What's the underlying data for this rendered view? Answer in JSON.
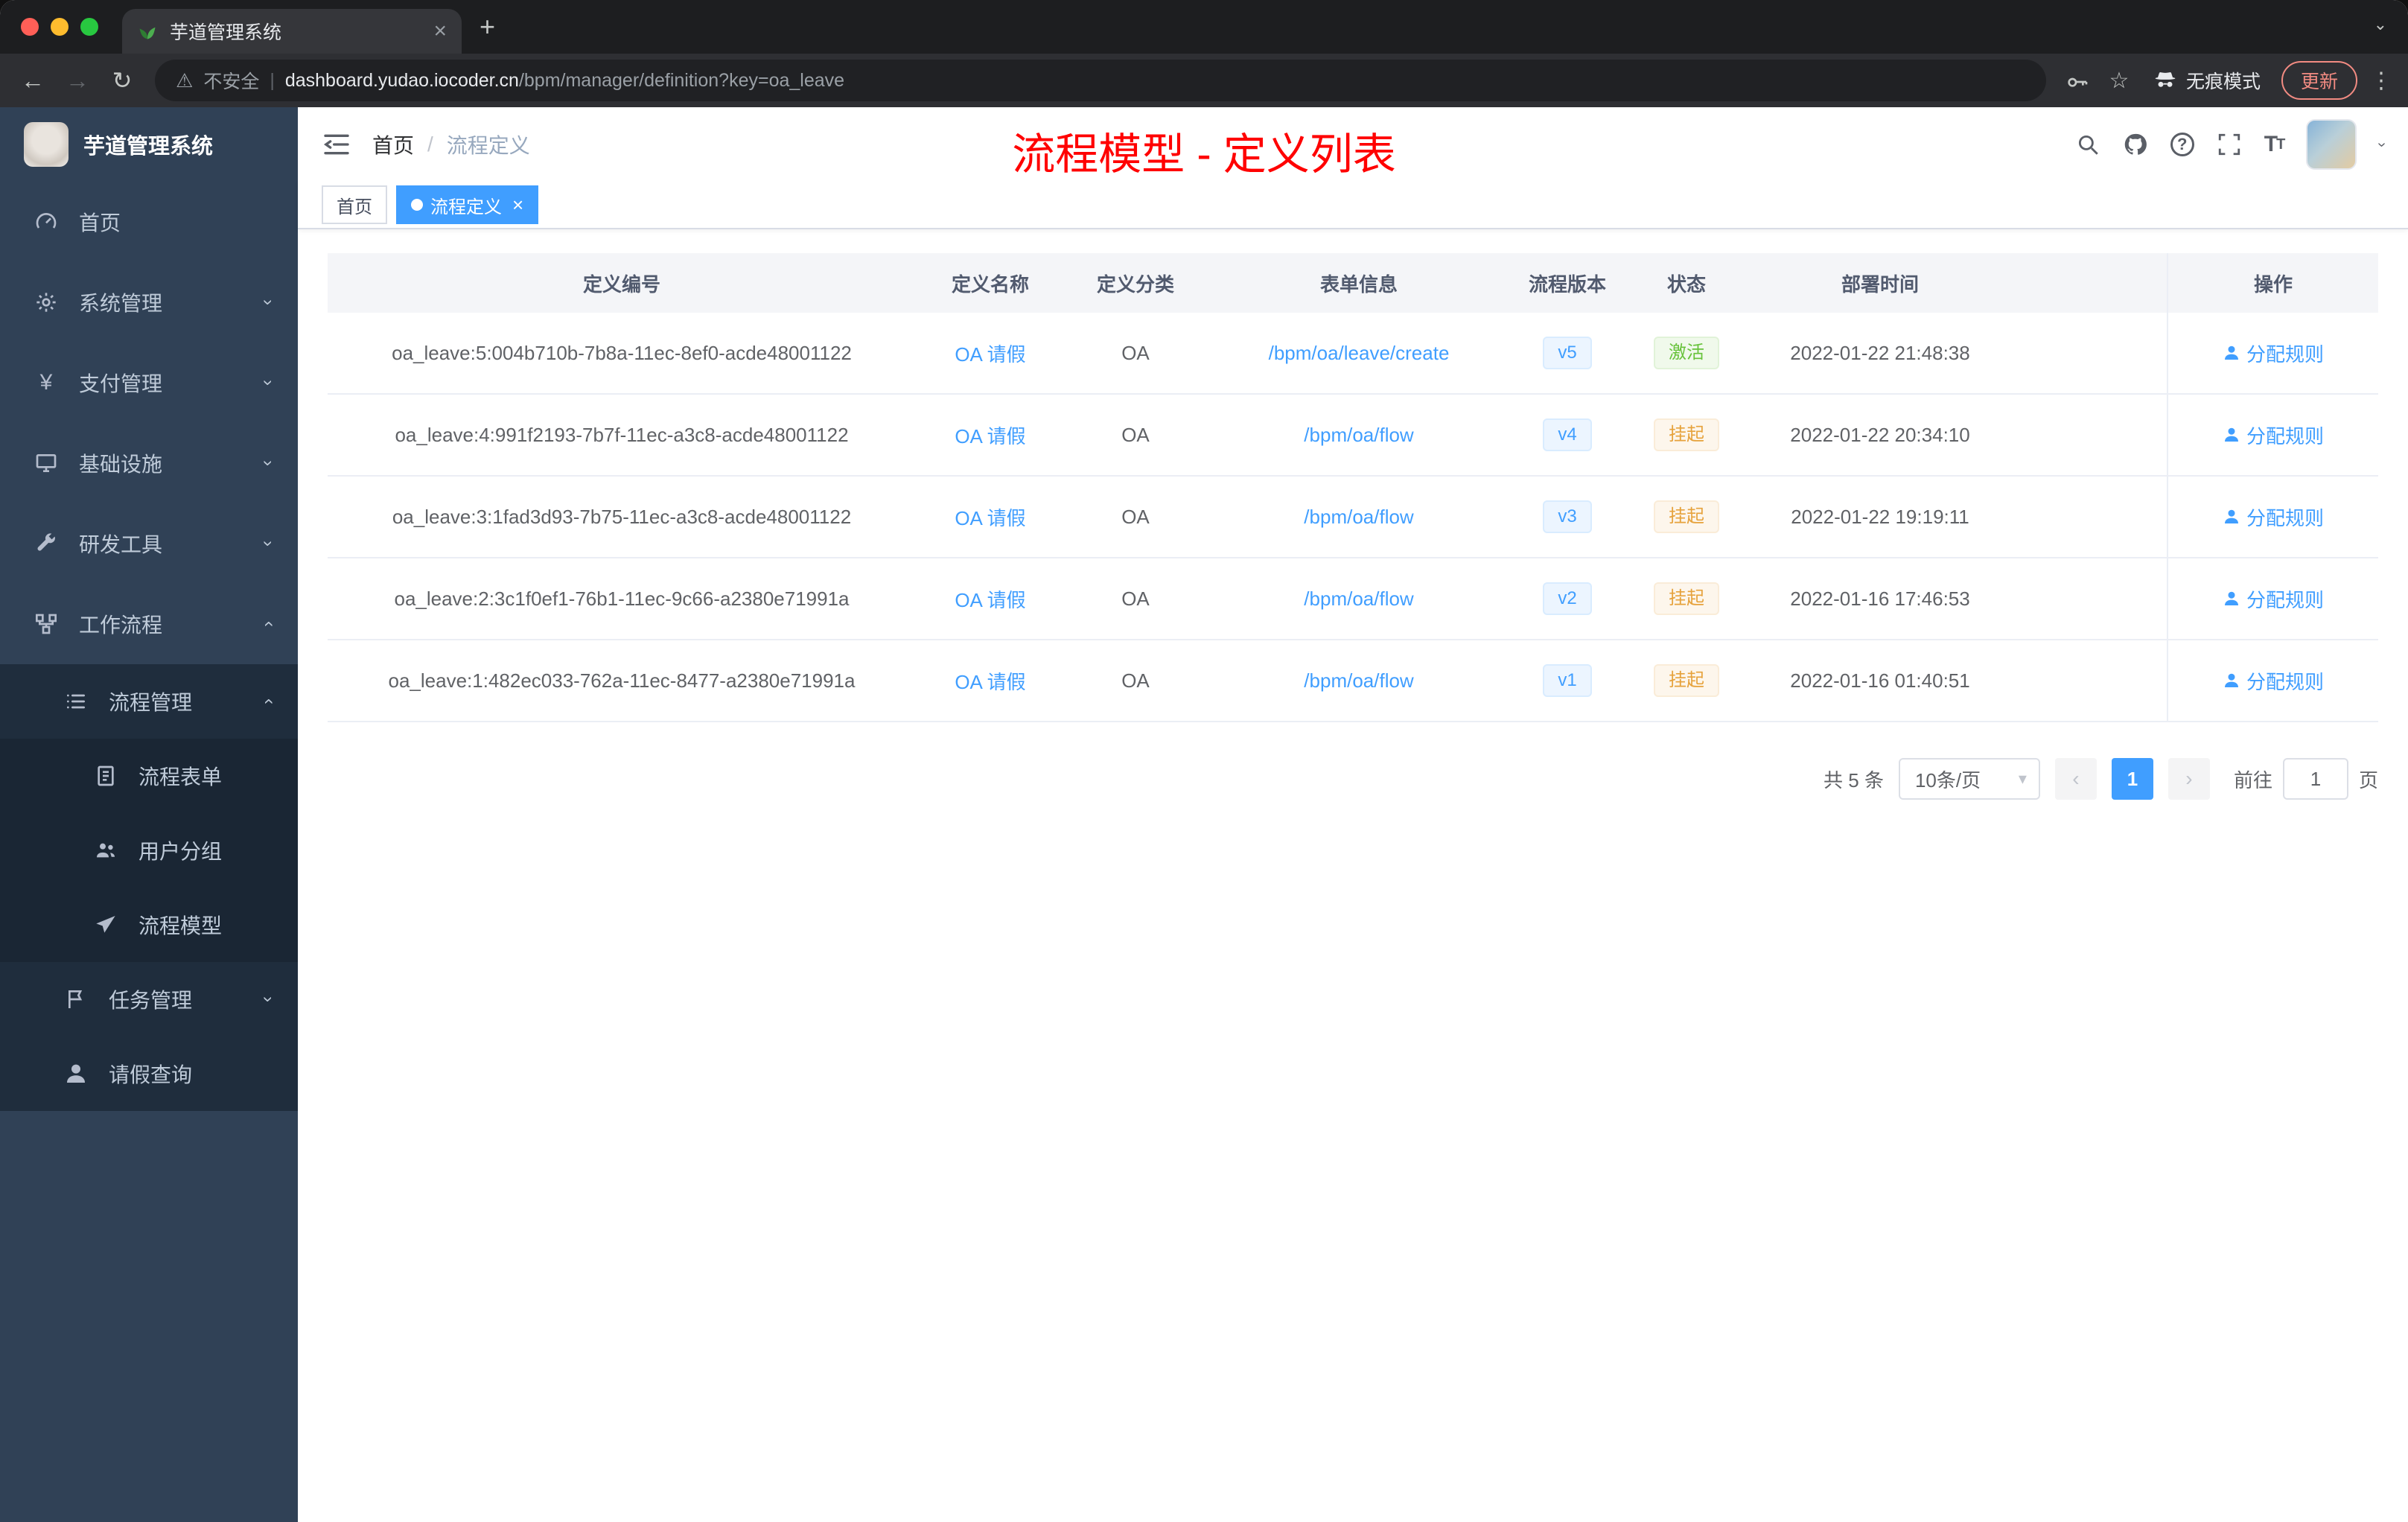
{
  "browser": {
    "tab_title": "芋道管理系统",
    "security_label": "不安全",
    "url_host": "dashboard.yudao.iocoder.cn",
    "url_path": "/bpm/manager/definition?key=oa_leave",
    "incognito_label": "无痕模式",
    "update_label": "更新"
  },
  "sidebar": {
    "logo_title": "芋道管理系统",
    "items": [
      {
        "label": "首页"
      },
      {
        "label": "系统管理"
      },
      {
        "label": "支付管理"
      },
      {
        "label": "基础设施"
      },
      {
        "label": "研发工具"
      },
      {
        "label": "工作流程"
      },
      {
        "label": "流程管理"
      },
      {
        "label": "流程表单"
      },
      {
        "label": "用户分组"
      },
      {
        "label": "流程模型"
      },
      {
        "label": "任务管理"
      },
      {
        "label": "请假查询"
      }
    ]
  },
  "header": {
    "breadcrumb_home": "首页",
    "breadcrumb_sep": "/",
    "breadcrumb_current": "流程定义",
    "overlay_title": "流程模型 - 定义列表"
  },
  "tags": {
    "home": "首页",
    "active": "流程定义"
  },
  "table": {
    "columns": {
      "id": "定义编号",
      "name": "定义名称",
      "category": "定义分类",
      "form": "表单信息",
      "version": "流程版本",
      "status": "状态",
      "time": "部署时间",
      "action": "操作"
    },
    "action_label": "分配规则",
    "rows": [
      {
        "id": "oa_leave:5:004b710b-7b8a-11ec-8ef0-acde48001122",
        "name": "OA 请假",
        "category": "OA",
        "form": "/bpm/oa/leave/create",
        "version": "v5",
        "status": "激活",
        "time": "2022-01-22 21:48:38"
      },
      {
        "id": "oa_leave:4:991f2193-7b7f-11ec-a3c8-acde48001122",
        "name": "OA 请假",
        "category": "OA",
        "form": "/bpm/oa/flow",
        "version": "v4",
        "status": "挂起",
        "time": "2022-01-22 20:34:10"
      },
      {
        "id": "oa_leave:3:1fad3d93-7b75-11ec-a3c8-acde48001122",
        "name": "OA 请假",
        "category": "OA",
        "form": "/bpm/oa/flow",
        "version": "v3",
        "status": "挂起",
        "time": "2022-01-22 19:19:11"
      },
      {
        "id": "oa_leave:2:3c1f0ef1-76b1-11ec-9c66-a2380e71991a",
        "name": "OA 请假",
        "category": "OA",
        "form": "/bpm/oa/flow",
        "version": "v2",
        "status": "挂起",
        "time": "2022-01-16 17:46:53"
      },
      {
        "id": "oa_leave:1:482ec033-762a-11ec-8477-a2380e71991a",
        "name": "OA 请假",
        "category": "OA",
        "form": "/bpm/oa/flow",
        "version": "v1",
        "status": "挂起",
        "time": "2022-01-16 01:40:51"
      }
    ]
  },
  "pagination": {
    "total": "共 5 条",
    "page_size": "10条/页",
    "page": "1",
    "goto": "前往",
    "goto_value": "1",
    "unit": "页"
  },
  "colors": {
    "accent_blue": "#409eff",
    "success_green": "#67c23a",
    "warning_orange": "#e6a23c",
    "annotation_red": "#ff0000",
    "sidebar_bg": "#304156"
  }
}
